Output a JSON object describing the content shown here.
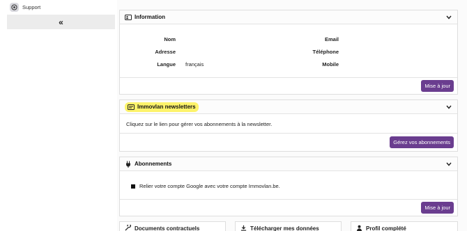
{
  "sidebar": {
    "support_label": "Support",
    "collapse_label": "«"
  },
  "information": {
    "title": "Information",
    "fields": {
      "nom_label": "Nom",
      "adresse_label": "Adresse",
      "langue_label": "Langue",
      "langue_value": "français",
      "email_label": "Email",
      "telephone_label": "Téléphone",
      "mobile_label": "Mobile"
    },
    "save_label": "Mise à jour"
  },
  "newsletters": {
    "title": "Immovlan newsletters",
    "description": "Cliquez sur le lien pour gérer vos abonnements à la newsletter.",
    "manage_label": "Gérez vos abonnements"
  },
  "abonnements": {
    "title": "Abonnements",
    "google_link_text": "Relier votre compte Google avec votre compte Immovlan.be.",
    "save_label": "Mise à jour"
  },
  "bottom_tabs": {
    "documents": "Documents contractuels",
    "download": "Télécharger mes données",
    "profile": "Profil complété"
  },
  "colors": {
    "accent": "#6a3d8f",
    "highlight": "#fdf36b"
  }
}
